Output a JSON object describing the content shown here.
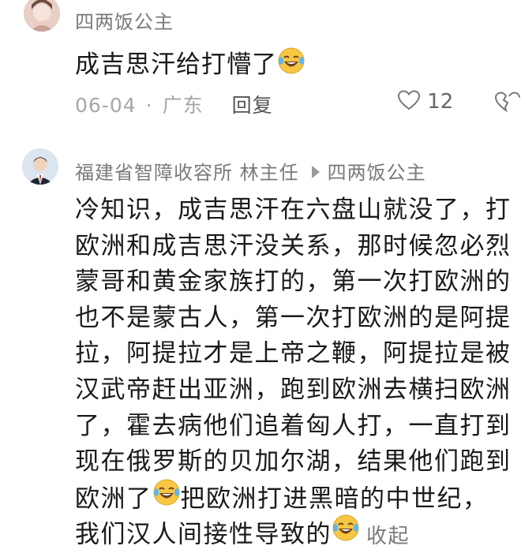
{
  "comment1": {
    "username": "四两饭公主",
    "text": "成吉思汗给打懵了",
    "date": "06-04",
    "location": "广东",
    "reply_label": "回复",
    "likes": "12"
  },
  "comment2": {
    "username": "福建省智障收容所 林主任",
    "reply_to": "四两饭公主",
    "lines": [
      "冷知识，成吉思汗在六盘山就没了，打",
      "欧洲和成吉思汗没关系，那时候忽必烈",
      "蒙哥和黄金家族打的，第一次打欧洲的",
      "也不是蒙古人，第一次打欧洲的是阿提",
      "拉，阿提拉才是上帝之鞭，阿提拉是被",
      "汉武帝赶出亚洲，跑到欧洲去横扫欧洲",
      "了，霍去病他们追着匈人打，一直打到",
      "现在俄罗斯的贝加尔湖，结果他们跑到"
    ],
    "line9_part1": "欧洲了",
    "line9_part2": "把欧洲打进黑暗的中世纪，",
    "line10": "我们汉人间接性导致的",
    "collapse_label": "收起"
  },
  "colors": {
    "username": "#7a7a7a",
    "body_text": "#1a1a1a",
    "meta_text": "#a6a6a6",
    "emoji_face": "#f7c744"
  },
  "icons": {
    "laugh_emoji": "laughing-crying-emoji-icon",
    "like": "heart-outline-icon",
    "dislike": "broken-heart-icon",
    "reply_arrow": "reply-arrow-icon"
  }
}
